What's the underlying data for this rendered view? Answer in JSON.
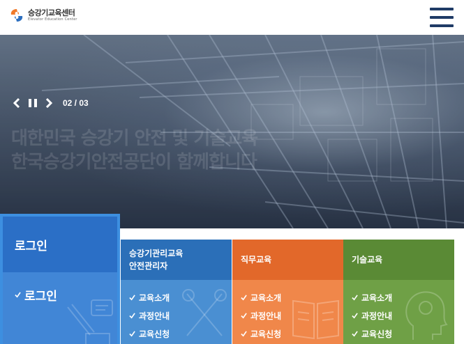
{
  "header": {
    "logo_title": "승강기교육센터",
    "logo_subtitle": "Elevator Education Center",
    "menu_icon": "hamburger-menu-icon"
  },
  "hero": {
    "pager": "02 / 03",
    "caption_line1": "대한민국 승강기 안전 및 기술교육",
    "caption_line2": "한국승강기안전공단이 함께합니다",
    "controls": [
      "chevron-left-icon",
      "pause-icon",
      "chevron-right-icon"
    ]
  },
  "login": {
    "title": "로그인",
    "link_label": "로그인"
  },
  "categories": [
    {
      "title_line1": "승강기관리교육",
      "title_line2": "안전관리자",
      "items": [
        "교육소개",
        "과정안내",
        "교육신청"
      ],
      "head_color": "#2b6fb8",
      "body_color": "#4a8fd2"
    },
    {
      "title_line1": "직무교육",
      "title_line2": "",
      "items": [
        "교육소개",
        "과정안내",
        "교육신청"
      ],
      "head_color": "#e2682a",
      "body_color": "#f0874a"
    },
    {
      "title_line1": "기술교육",
      "title_line2": "",
      "items": [
        "교육소개",
        "과정안내",
        "교육신청"
      ],
      "head_color": "#5a8a35",
      "body_color": "#6fa046"
    }
  ],
  "colors": {
    "brand_navy": "#1f3b66",
    "login_blue": "#2b6fc6",
    "login_border": "#3d8fe0"
  }
}
